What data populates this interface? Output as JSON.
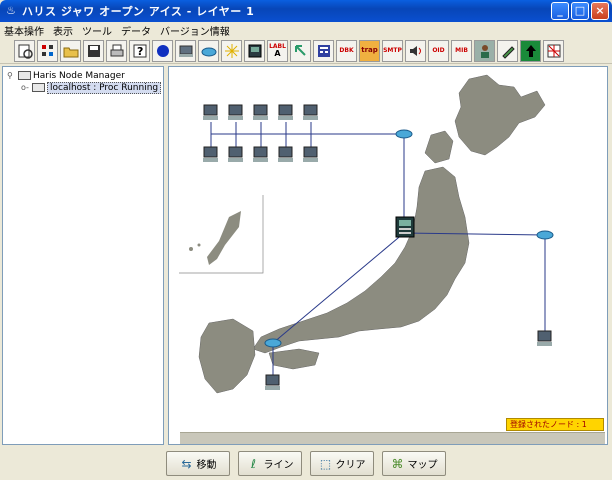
{
  "window": {
    "title": "ハリス ジャワ オープン アイス - レイヤー 1"
  },
  "menu": {
    "items": [
      "基本操作",
      "表示",
      "ツール",
      "データ",
      "バージョン情報"
    ]
  },
  "toolbar": {
    "buttons": [
      {
        "icon": "refresh-document-icon"
      },
      {
        "icon": "node-list-icon"
      },
      {
        "icon": "open-folder-icon"
      },
      {
        "icon": "save-disk-icon"
      },
      {
        "icon": "printer-icon"
      },
      {
        "icon": "help-question-icon"
      },
      {
        "icon": "blue-circle-icon"
      },
      {
        "icon": "computer-node-icon"
      },
      {
        "icon": "router-cloud-icon"
      },
      {
        "icon": "sparkle-icon"
      },
      {
        "icon": "device-box-icon"
      },
      {
        "icon": "label-text-icon",
        "text": "LABL\nA"
      },
      {
        "icon": "pointer-arrow-icon"
      },
      {
        "icon": "calculator-grid-icon"
      },
      {
        "icon": "db-window-icon",
        "text": "DBK"
      },
      {
        "icon": "trap-icon",
        "text": "trap"
      },
      {
        "icon": "smtp-icon",
        "text": "SMTP"
      },
      {
        "icon": "speaker-icon"
      },
      {
        "icon": "oid-icon",
        "text": "OID"
      },
      {
        "icon": "mib-icon",
        "text": "MIB"
      },
      {
        "icon": "person-icon"
      },
      {
        "icon": "edit-pen-icon"
      },
      {
        "icon": "green-up-arrow-icon"
      },
      {
        "icon": "grid-x-icon"
      }
    ]
  },
  "tree": {
    "root_label": "Haris Node Manager",
    "child_label": "localhost : Proc Running"
  },
  "map": {
    "node_count_label": "登録されたノード : 1"
  },
  "bottom_buttons": [
    {
      "label": "移動",
      "icon": "move-arrows-icon"
    },
    {
      "label": "ライン",
      "icon": "line-draw-icon"
    },
    {
      "label": "クリア",
      "icon": "clear-selection-icon"
    },
    {
      "label": "マップ",
      "icon": "map-icon"
    }
  ],
  "colors": {
    "titlebar": "#0a4fd0",
    "map_land": "#8c8c80",
    "link_line": "#2a3a8a",
    "node_count_bg": "#ffd400"
  }
}
